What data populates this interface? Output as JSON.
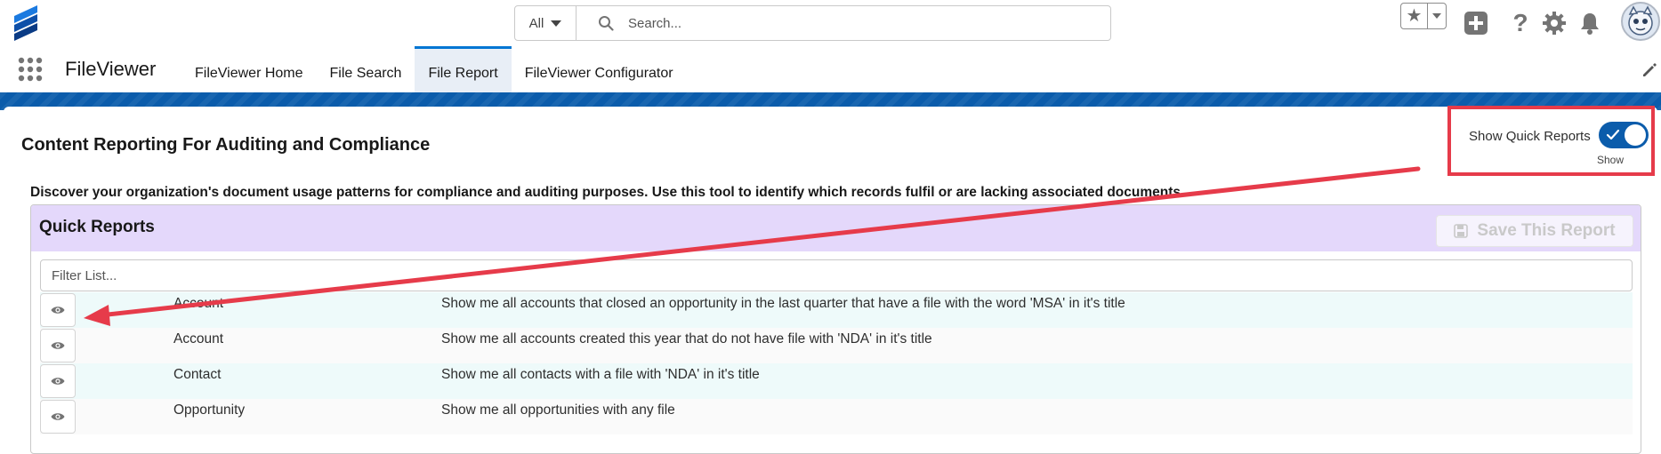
{
  "header": {
    "search": {
      "scope": "All",
      "placeholder": "Search..."
    },
    "help_glyph": "?",
    "icons": [
      "logo-icon",
      "chevron-down-icon",
      "search-icon",
      "star-icon",
      "plus-icon",
      "help-icon",
      "gear-icon",
      "bell-icon",
      "avatar"
    ]
  },
  "nav": {
    "app_name": "FileViewer",
    "tabs": [
      {
        "label": "FileViewer Home",
        "active": false
      },
      {
        "label": "File Search",
        "active": false
      },
      {
        "label": "File Report",
        "active": true
      },
      {
        "label": "FileViewer Configurator",
        "active": false
      }
    ]
  },
  "main": {
    "title": "Content Reporting For Auditing and Compliance",
    "description": "Discover your organization's document usage patterns for compliance and auditing purposes. Use this tool to identify which records fulfil or are lacking associated documents.",
    "quick_toggle": {
      "label": "Show Quick Reports",
      "state_label": "Show",
      "checked": true
    },
    "quick_reports": {
      "title": "Quick Reports",
      "save_label": "Save This Report",
      "filter_placeholder": "Filter List...",
      "rows": [
        {
          "object": "Account",
          "description": "Show me all accounts that closed an opportunity in the last quarter that have a file with the word 'MSA' in it's title"
        },
        {
          "object": "Account",
          "description": "Show me all accounts created this year that do not have file with 'NDA' in it's title"
        },
        {
          "object": "Contact",
          "description": "Show me all contacts with a file with 'NDA' in it's title"
        },
        {
          "object": "Opportunity",
          "description": "Show me all opportunities with any file"
        }
      ]
    }
  },
  "colors": {
    "brand_blue": "#0b5cab",
    "active_tab_border": "#0176d3",
    "panel_header": "#e4d8fb",
    "annotation_red": "#e63b4a"
  }
}
